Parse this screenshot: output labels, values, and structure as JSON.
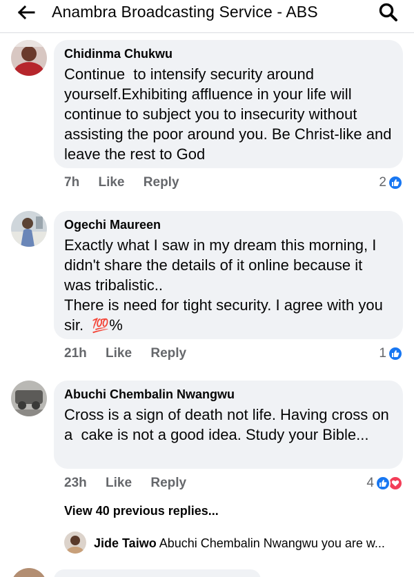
{
  "header": {
    "back_icon": "arrow-left-icon",
    "title": "Anambra Broadcasting Service - ABS",
    "search_icon": "search-icon"
  },
  "comments": [
    {
      "author": "Chidinma Chukwu",
      "text": "Continue  to intensify security around yourself.Exhibiting affluence in your life will continue to subject you to insecurity without assisting the poor around you. Be Christ-like and leave the rest to God",
      "time": "7h",
      "like_label": "Like",
      "reply_label": "Reply",
      "reaction_count": "2",
      "reactions": [
        "like"
      ]
    },
    {
      "author": "Ogechi Maureen",
      "text_lines": [
        "Exactly what I saw in my dream this morning, I didn't share the details of it online because it was tribalistic..",
        "There is need for tight security. I agree with you sir."
      ],
      "emoji": "💯",
      "emoji_suffix": "%",
      "time": "21h",
      "like_label": "Like",
      "reply_label": "Reply",
      "reaction_count": "1",
      "reactions": [
        "like"
      ]
    },
    {
      "author": "Abuchi Chembalin Nwangwu",
      "text": "Cross is a sign of death not life. Having cross on a  cake is not a good idea. Study your Bible...",
      "time": "23h",
      "like_label": "Like",
      "reply_label": "Reply",
      "reaction_count": "4",
      "reactions": [
        "like",
        "love"
      ]
    }
  ],
  "view_previous_replies": "View 40 previous replies...",
  "reply_preview": {
    "author": "Jide Taiwo",
    "text": "Abuchi Chembalin Nwangwu you are w..."
  },
  "colors": {
    "bubble_bg": "#f0f2f5",
    "meta_text": "#65676b",
    "like_blue": "#1877f2",
    "love_red": "#f33e58"
  }
}
